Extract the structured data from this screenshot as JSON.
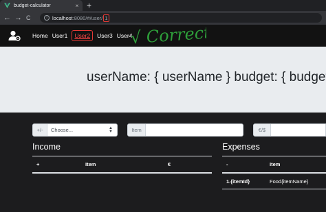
{
  "browser": {
    "tab_title": "budget-calculator",
    "tab_close": "×",
    "new_tab": "+",
    "back": "←",
    "forward": "→",
    "reload": "C",
    "home": "⌂",
    "url_host": "localhost",
    "url_port_path": ":8080/#/user/",
    "url_id": "1"
  },
  "navbar": {
    "links": [
      "Home",
      "User1",
      "User2",
      "User3",
      "User4"
    ],
    "active_link": "User2",
    "annotation_text": "√ Correct"
  },
  "jumbotron": {
    "heading": "userName: { userName } budget: { budget }"
  },
  "controls": {
    "sign_addon": "+/-",
    "select_placeholder": "Choose...",
    "item_addon": "Item",
    "item_value": "",
    "money_addon": "€/$",
    "money_value": ""
  },
  "income": {
    "title": "Income",
    "columns": [
      "+",
      "Item",
      "€"
    ]
  },
  "expenses": {
    "title": "Expenses",
    "columns": [
      "-",
      "Item"
    ],
    "rows": [
      [
        "1.{itemId}",
        "Food{itemName}"
      ]
    ]
  },
  "colors": {
    "navbar_bg": "#121212",
    "jumbotron_bg": "#e9ecef",
    "body_bg": "#1c1c1e",
    "annotation": "#2e9e3a",
    "highlight": "#e53935"
  }
}
